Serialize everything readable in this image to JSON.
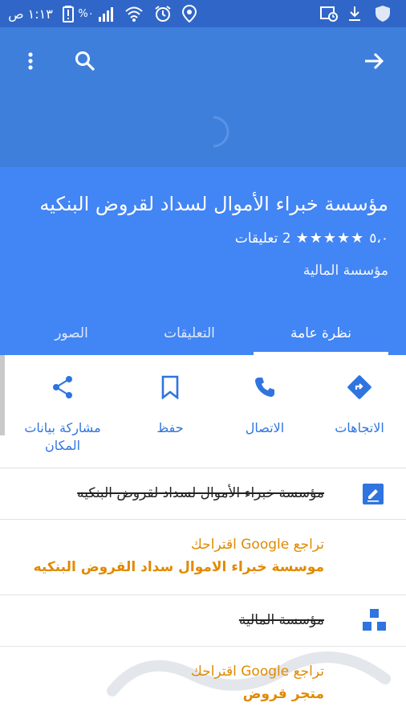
{
  "status_bar": {
    "time": "١:١٣ ص",
    "battery": "%٠"
  },
  "place": {
    "name": "مؤسسة خبراء الأموال لسداد لقروض البنكيه",
    "rating_value": "٥،٠",
    "stars": "★★★★★",
    "reviews_count": "2 تعليقات",
    "category": "مؤسسة المالية"
  },
  "tabs": [
    "نظرة عامة",
    "التعليقات",
    "الصور"
  ],
  "actions": {
    "directions": "الاتجاهات",
    "call": "الاتصال",
    "save": "حفظ",
    "share": "مشاركة بيانات المكان"
  },
  "edits": {
    "name_old": "مؤسسة خبراء الأموال لسداد لقروض البنكيه",
    "name_suggestion_header": "تراجع Google اقتراحك",
    "name_suggestion_value": "موسسة خبراء الاموال سداد القروض البنكيه",
    "category_old": "مؤسسة المالية",
    "category_suggestion_header": "تراجع Google اقتراحك",
    "category_suggestion_value": "متجر قروض"
  },
  "colors": {
    "status_bar": "#3066c7",
    "header": "#3f7fdc",
    "title_bar": "#4285f4",
    "action_blue": "#2f74e0",
    "suggestion_orange": "#e08a00"
  }
}
